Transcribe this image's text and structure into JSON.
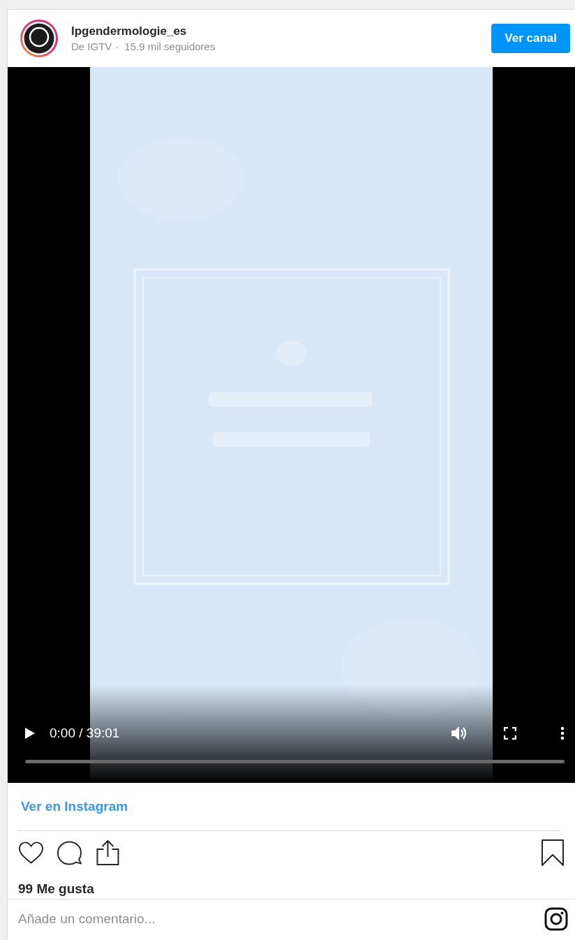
{
  "header": {
    "username": "lpgendermologie_es",
    "source": "De IGTV",
    "separator": "·",
    "followers": "15.9 mil seguidores",
    "button": "Ver canal"
  },
  "video": {
    "kind": "picture",
    "time": "0:00 / 39:01",
    "progress": {
      "level": 0
    }
  },
  "link": "Ver en Instagram",
  "likes": "99 Me gusta",
  "comment": {
    "placeholder": "Añade un comentario..."
  }
}
